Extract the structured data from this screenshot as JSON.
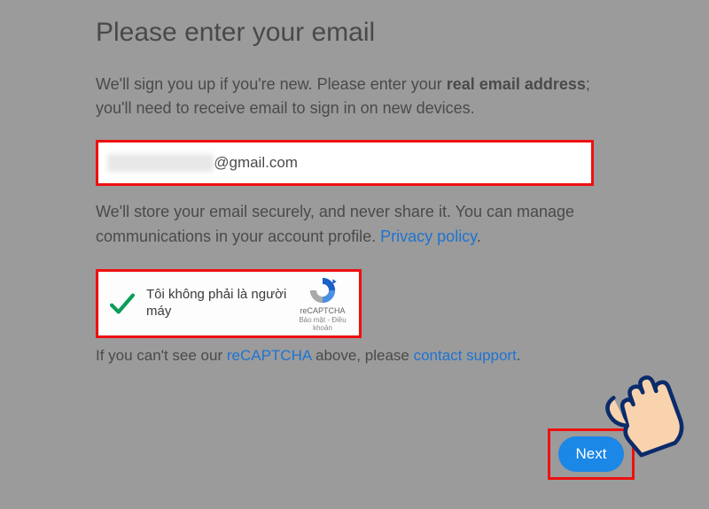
{
  "title": "Please enter your email",
  "intro": {
    "pre": "We'll sign you up if you're new. Please enter your ",
    "bold": "real email address",
    "post": "; you'll need to receive email to sign in on new devices."
  },
  "email": {
    "visible_suffix": "@gmail.com"
  },
  "store": {
    "pre": "We'll store your email securely, and never share it. You can manage communications in your account profile. ",
    "privacy_link": "Privacy policy",
    "post": "."
  },
  "captcha": {
    "label": "Tôi không phải là người máy",
    "brand": "reCAPTCHA",
    "privacy": "Bảo mật",
    "sep": " - ",
    "terms": "Điều khoản"
  },
  "fallback": {
    "pre": "If you can't see our ",
    "recaptcha_link": "reCAPTCHA",
    "mid": " above, please ",
    "support_link": "contact support",
    "post": "."
  },
  "next_label": "Next"
}
